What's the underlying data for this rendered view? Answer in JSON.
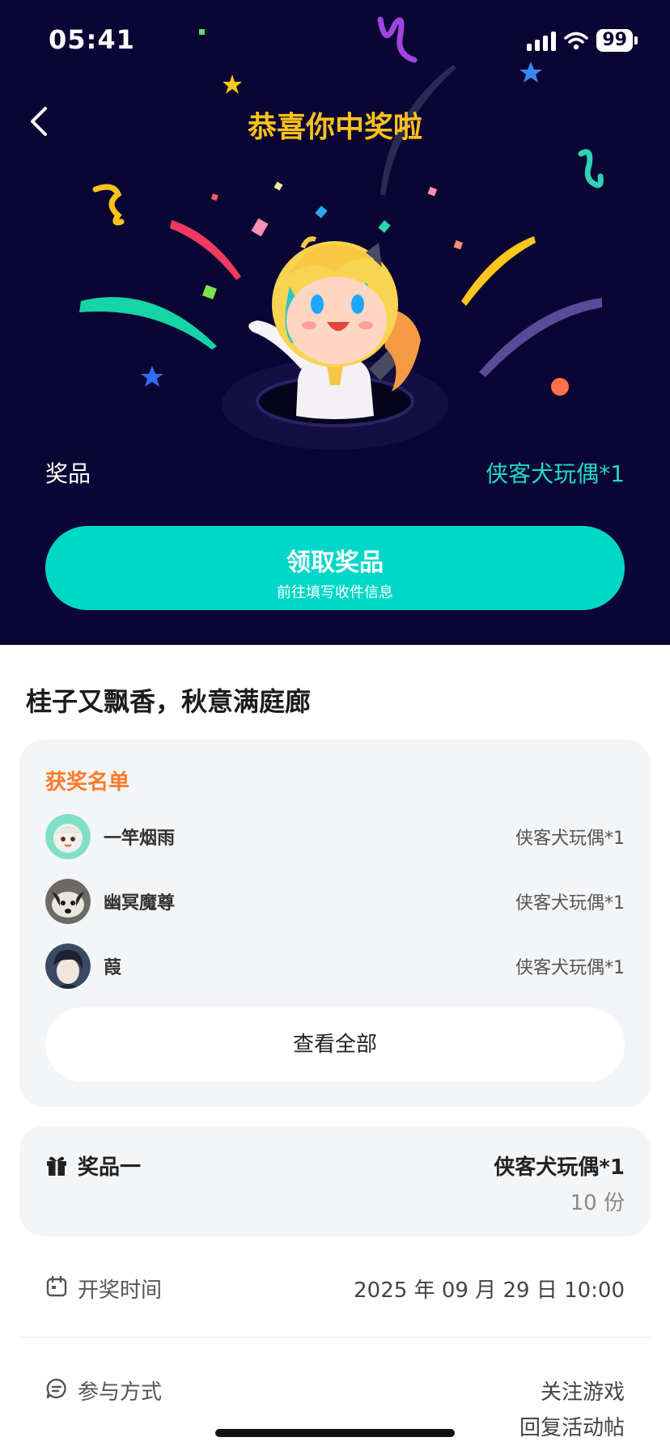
{
  "status": {
    "time": "05:41",
    "battery": "99"
  },
  "header": {
    "title": "恭喜你中奖啦",
    "back_icon": "back-arrow-icon"
  },
  "hero": {
    "prize_label": "奖品",
    "prize_value": "侠客犬玩偶*1",
    "claim_button": {
      "label": "领取奖品",
      "sublabel": "前往填写收件信息"
    }
  },
  "event": {
    "title": "桂子又飘香，秋意满庭廊"
  },
  "winners": {
    "title": "获奖名单",
    "items": [
      {
        "name": "一竿烟雨",
        "prize": "侠客犬玩偶*1"
      },
      {
        "name": "幽冥魔尊",
        "prize": "侠客犬玩偶*1"
      },
      {
        "name": "葭",
        "prize": "侠客犬玩偶*1"
      }
    ],
    "view_all": "查看全部"
  },
  "prize_detail": {
    "name": "奖品一",
    "item": "侠客犬玩偶*1",
    "quantity": "10 份"
  },
  "draw_time": {
    "label": "开奖时间",
    "value": "2025 年 09 月 29 日 10:00"
  },
  "participation": {
    "label": "参与方式",
    "value_line1": "关注游戏",
    "value_line2": "回复活动帖"
  },
  "colors": {
    "hero_bg": "#0a0533",
    "accent": "#00d7c8",
    "title": "#ffc21a",
    "winners_title": "#ff7a2a"
  }
}
